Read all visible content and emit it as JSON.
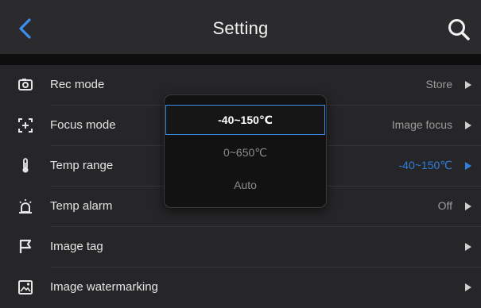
{
  "header": {
    "title": "Setting",
    "back_icon": "chevron-left-icon",
    "search_icon": "search-icon"
  },
  "settings": [
    {
      "label": "Rec mode",
      "value": "Store",
      "icon": "camera-icon"
    },
    {
      "label": "Focus mode",
      "value": "Image focus",
      "icon": "focus-crosshair-icon"
    },
    {
      "label": "Temp range",
      "value": "-40~150℃",
      "icon": "thermometer-icon",
      "active": true
    },
    {
      "label": "Temp alarm",
      "value": "Off",
      "icon": "alarm-icon"
    },
    {
      "label": "Image tag",
      "value": "",
      "icon": "flag-icon"
    },
    {
      "label": "Image watermarking",
      "value": "",
      "icon": "watermark-icon"
    }
  ],
  "temp_range_dropdown": {
    "options": [
      "-40~150℃",
      "0~650℃",
      "Auto"
    ],
    "selected": "-40~150℃"
  },
  "colors": {
    "accent": "#2f7fe0",
    "background": "#262628",
    "header": "#2b2b2e",
    "dropdown_bg": "#121213"
  }
}
